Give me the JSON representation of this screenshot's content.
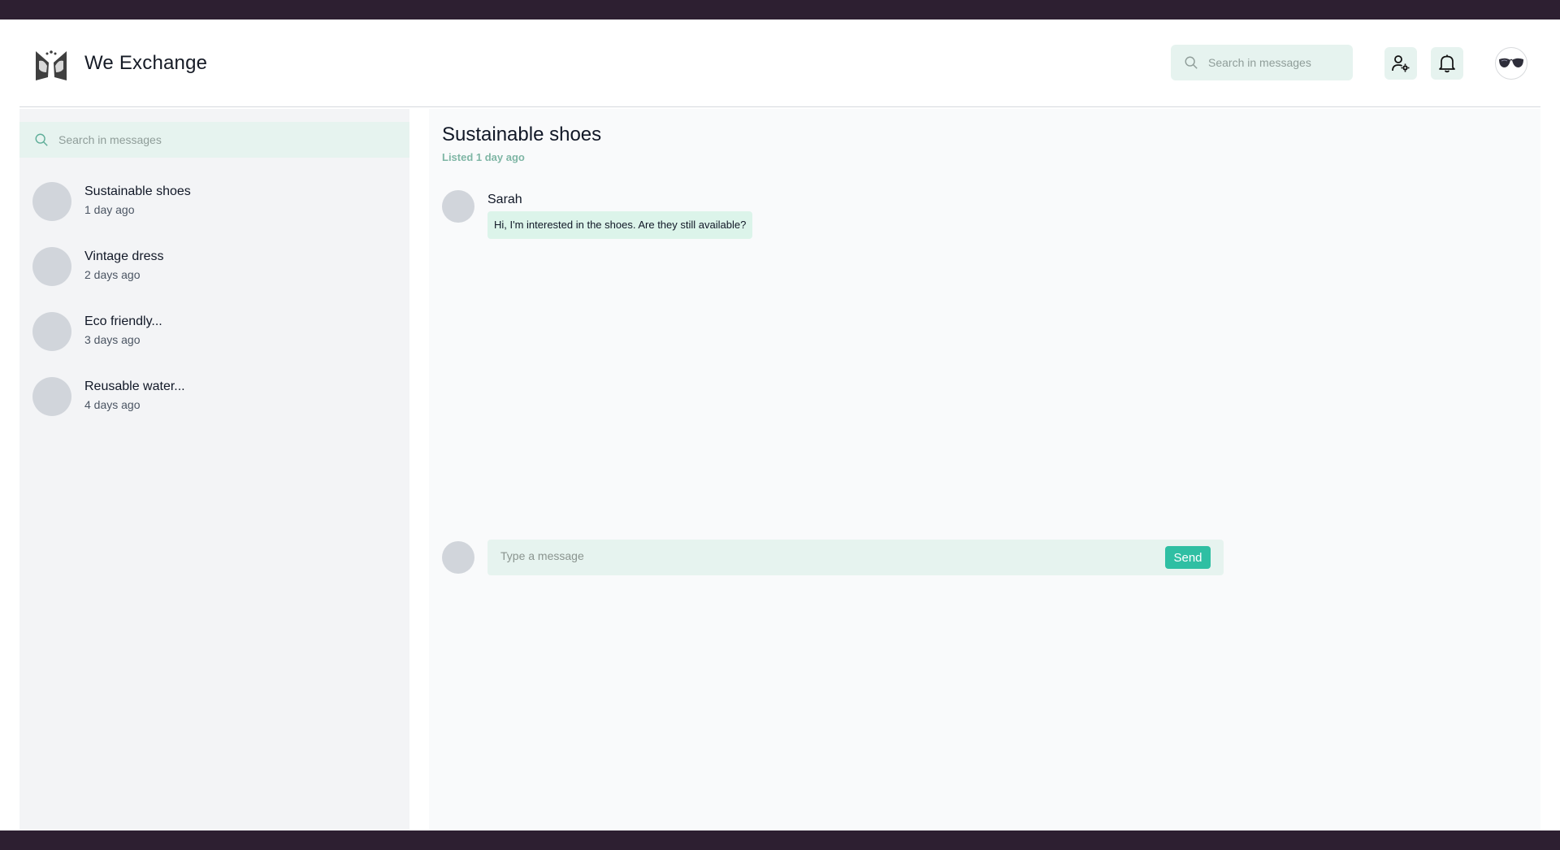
{
  "header": {
    "brand": "We Exchange",
    "search_placeholder": "Search in messages"
  },
  "sidebar": {
    "search_placeholder": "Search in messages",
    "conversations": [
      {
        "title": "Sustainable shoes",
        "time": "1 day ago"
      },
      {
        "title": "Vintage dress",
        "time": "2 days ago"
      },
      {
        "title": "Eco friendly...",
        "time": "3 days ago"
      },
      {
        "title": "Reusable water...",
        "time": "4 days ago"
      }
    ]
  },
  "chat": {
    "title": "Sustainable shoes",
    "subtitle": "Listed 1 day ago",
    "messages": [
      {
        "sender": "Sarah",
        "text": "Hi, I'm interested in the shoes. Are they still available?"
      }
    ],
    "compose_placeholder": "Type a message",
    "send_label": "Send"
  },
  "icons": {
    "logo": "butterfly-logo",
    "search": "search-icon",
    "user_settings": "user-settings-icon",
    "notifications": "bell-icon",
    "profile": "avatar"
  },
  "colors": {
    "accent": "#2fbfa3",
    "input_bg": "#e6f3ef",
    "bubble_bg": "#dcf4ea",
    "subtitle": "#7fb6a5"
  }
}
